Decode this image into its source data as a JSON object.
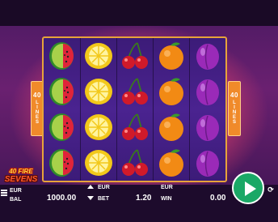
{
  "game": {
    "logo_line1": "40 FIRE",
    "logo_line2": "SEVENS",
    "lines_count": "40",
    "lines_word": "LINES"
  },
  "reels": [
    [
      "watermelon-icon",
      "watermelon-icon",
      "watermelon-icon",
      "watermelon-icon"
    ],
    [
      "lemon-icon",
      "lemon-icon",
      "lemon-icon",
      "lemon-icon"
    ],
    [
      "cherry-icon",
      "cherry-icon",
      "cherry-icon",
      "cherry-icon"
    ],
    [
      "orange-icon",
      "orange-icon",
      "orange-icon",
      "orange-icon"
    ],
    [
      "plum-icon",
      "plum-icon",
      "plum-icon",
      "plum-icon"
    ]
  ],
  "bottom": {
    "menu_hint": "≡",
    "balance_currency": "EUR",
    "balance_label": "BAL",
    "balance_value": "1000.00",
    "bet_currency": "EUR",
    "bet_label": "BET",
    "bet_value": "1.20",
    "win_currency": "EUR",
    "win_label": "WIN",
    "win_value": "0.00",
    "autoplay_symbol": "⟳",
    "play_button": "play-icon"
  },
  "colors": {
    "frame": "#e7a33a",
    "reel_bg": "#3c1b78",
    "play_button": "#1aa866",
    "badge": "#f08a2a"
  }
}
